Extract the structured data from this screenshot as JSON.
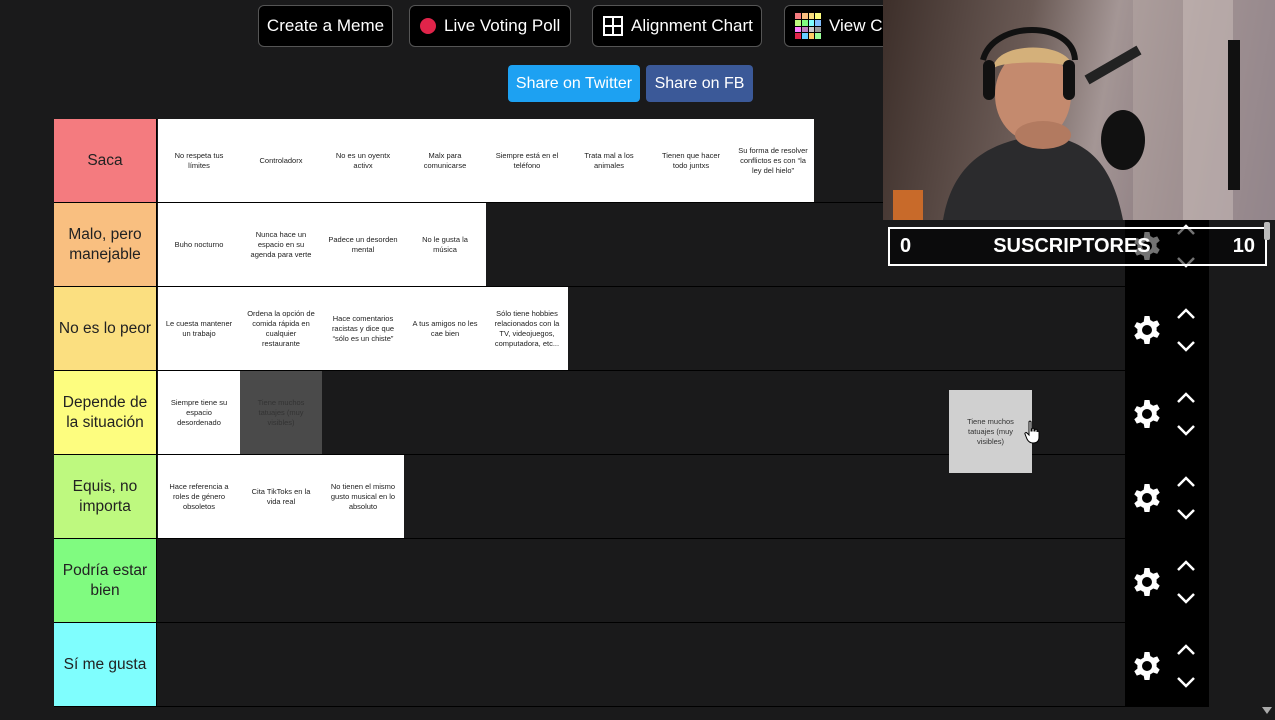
{
  "toolbar": {
    "create_meme": "Create a Meme",
    "live_poll": "Live Voting Poll",
    "alignment_chart": "Alignment Chart",
    "view_colors": "View Co"
  },
  "share": {
    "twitter": "Share on Twitter",
    "fb": "Share on FB",
    "twitter_color": "#1da1f2",
    "fb_color": "#3b5998"
  },
  "tiers": [
    {
      "label": "Saca",
      "color": "#f47b7f",
      "items": [
        {
          "text": "No respeta tus límites"
        },
        {
          "text": "Controladorx"
        },
        {
          "text": "No es un oyentx activx"
        },
        {
          "text": "Malx para comunicarse"
        },
        {
          "text": "Siempre está en el teléfono"
        },
        {
          "text": "Trata mal a los animales"
        },
        {
          "text": "Tienen que hacer todo juntxs"
        },
        {
          "text": "Su forma de resolver conflictos es con “la ley del hielo”"
        }
      ]
    },
    {
      "label": "Malo, pero manejable",
      "color": "#f9bf80",
      "items": [
        {
          "text": "Buho nocturno"
        },
        {
          "text": "Nunca hace un espacio en su agenda para verte"
        },
        {
          "text": "Padece un desorden mental"
        },
        {
          "text": "No le gusta la música"
        }
      ]
    },
    {
      "label": "No es lo peor",
      "color": "#fbdf80",
      "items": [
        {
          "text": "Le cuesta mantener un trabajo"
        },
        {
          "text": "Ordena la opción de comida rápida en cualquier restaurante"
        },
        {
          "text": "Hace comentarios racistas y dice que “sólo es un chiste”"
        },
        {
          "text": "A tus amigos no les cae bien"
        },
        {
          "text": "Sólo tiene hobbies relacionados con la TV, videojuegos, computadora, etc..."
        }
      ]
    },
    {
      "label": "Depende de la situación",
      "color": "#fdfd7f",
      "items": [
        {
          "text": "Siempre tiene su espacio desordenado"
        },
        {
          "text": "Tiene muchos tatuajes (muy visibles)",
          "ghost": true
        }
      ]
    },
    {
      "label": "Equis, no importa",
      "color": "#bef97f",
      "items": [
        {
          "text": "Hace referencia a roles de género obsoletos"
        },
        {
          "text": "Cita TikToks en la vida real"
        },
        {
          "text": "No tienen el mismo gusto musical en lo absoluto"
        }
      ]
    },
    {
      "label": "Podría estar bien",
      "color": "#80fb80",
      "items": []
    },
    {
      "label": "Sí me gusta",
      "color": "#7ffefe",
      "items": []
    }
  ],
  "dragged_item": {
    "text": "Tiene muchos tatuajes (muy visibles)"
  },
  "webcam": {
    "sub_count": "0",
    "sub_label": "SUSCRIPTORES",
    "sub_goal": "10"
  }
}
